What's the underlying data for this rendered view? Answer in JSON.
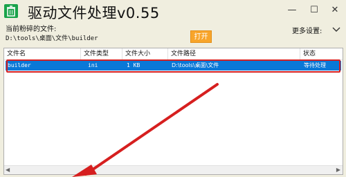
{
  "window": {
    "title": "驱动文件处理v0.55"
  },
  "window_controls": {
    "minimize": "—",
    "maximize": "☐",
    "close": "✕"
  },
  "file_panel": {
    "current_label": "当前粉碎的文件:",
    "path": "D:\\tools\\桌面\\文件\\builder",
    "open_label": "打开"
  },
  "settings": {
    "more_label": "更多设置:"
  },
  "table": {
    "columns": [
      "文件名",
      "文件类型",
      "文件大小",
      "文件路径",
      "状态"
    ],
    "rows": [
      {
        "name": "builder",
        "type": "ini",
        "size": "1 KB",
        "path": "D:\\tools\\桌面\\文件",
        "status": "等待处理"
      }
    ]
  },
  "colors": {
    "selection": "#0a78d7",
    "highlight_outline": "#d61f1f",
    "open_button": "#f8a52b",
    "icon": "#1aa34a"
  }
}
